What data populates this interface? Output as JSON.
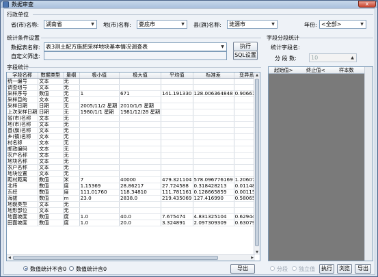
{
  "window": {
    "title": "数据审查",
    "close_label": "x"
  },
  "admin_group": {
    "title": "行政单位",
    "province_label": "省(市)名称:",
    "province_value": "湖南省",
    "city_label": "地(市)名称:",
    "city_value": "娄底市",
    "county_label": "县(旗)名称:",
    "county_value": "涟源市",
    "year_label": "年份:",
    "year_value": "<全部>"
  },
  "stats_cond": {
    "title": "统计条件设置",
    "table_label": "数据表名称:",
    "table_value": "表3测土配方施肥采样地块基本情况调查表",
    "filter_label": "自定义筛选:",
    "filter_value": "",
    "execute_label": "执行",
    "sql_label": "SQL设置"
  },
  "field_stats": {
    "title": "字段统计",
    "columns": [
      "字段名称",
      "数据类型",
      "量纲",
      "极小值",
      "极大值",
      "平均值",
      "标准差",
      "变异系"
    ],
    "rows": [
      [
        "统一编号",
        "文本",
        "无",
        "",
        "",
        "",
        "",
        ""
      ],
      [
        "调查组号",
        "文本",
        "无",
        "",
        "",
        "",
        "",
        ""
      ],
      [
        "采样序号",
        "数值",
        "无",
        "1",
        "671",
        "141.191330",
        "128.006364848",
        "0.906616"
      ],
      [
        "采样目的",
        "文本",
        "无",
        "",
        "",
        "",
        "",
        ""
      ],
      [
        "采样日期",
        "日期",
        "无",
        "2005/11/2 星期",
        "2010/1/5 星期",
        "",
        "",
        ""
      ],
      [
        "上次采样日期",
        "日期",
        "无",
        "1980/1/1 星期",
        "1981/12/28 星期",
        "",
        "",
        ""
      ],
      [
        "省(市)名称",
        "文本",
        "无",
        "",
        "",
        "",
        "",
        ""
      ],
      [
        "地(市)名称",
        "文本",
        "无",
        "",
        "",
        "",
        "",
        ""
      ],
      [
        "县(旗)名称",
        "文本",
        "无",
        "",
        "",
        "",
        "",
        ""
      ],
      [
        "乡(镇)名称",
        "文本",
        "无",
        "",
        "",
        "",
        "",
        ""
      ],
      [
        "村名称",
        "文本",
        "无",
        "",
        "",
        "",
        "",
        ""
      ],
      [
        "邮政编码",
        "文本",
        "无",
        "",
        "",
        "",
        "",
        ""
      ],
      [
        "农户名称",
        "文本",
        "无",
        "",
        "",
        "",
        "",
        ""
      ],
      [
        "地块名称",
        "文本",
        "无",
        "",
        "",
        "",
        "",
        ""
      ],
      [
        "农户名称",
        "文本",
        "无",
        "",
        "",
        "",
        "",
        ""
      ],
      [
        "地块位置",
        "文本",
        "无",
        "",
        "",
        "",
        "",
        ""
      ],
      [
        "距村距离",
        "数值",
        "米",
        "7",
        "40000",
        "479.321104",
        "578.096776169",
        "1.206074"
      ],
      [
        "北纬",
        "数值",
        "度",
        "1.15369",
        "28.86217",
        "27.724588",
        "0.318428213",
        "0.011485"
      ],
      [
        "东经",
        "数值",
        "度",
        "111.01760",
        "118.34810",
        "111.781161",
        "0.128665859",
        "0.001151"
      ],
      [
        "海拔",
        "数值",
        "m",
        "23.0",
        "2838.0",
        "219.435069",
        "127.416990",
        "0.580658"
      ],
      [
        "地貌类型",
        "文本",
        "无",
        "",
        "",
        "",
        "",
        ""
      ],
      [
        "地形部位",
        "文本",
        "无",
        "",
        "",
        "",
        "",
        ""
      ],
      [
        "地面坡度",
        "数值",
        "度",
        "1.0",
        "40.0",
        "7.675474",
        "4.831325104",
        "0.629448"
      ],
      [
        "田面坡度",
        "数值",
        "度",
        "1.0",
        "20.0",
        "3.324891",
        "2.097309309",
        "0.630796"
      ]
    ]
  },
  "segment_stats": {
    "title": "字段分段统计",
    "field_label": "统计字段名:",
    "count_label": "分 段 数:",
    "count_value": "10",
    "columns": [
      "起始值>",
      "终止值<",
      "样本数"
    ]
  },
  "bottom": {
    "radio_exclude_label": "数值统计不含0",
    "radio_include_label": "数值统计含0",
    "export_left_label": "导出",
    "radio_segment_label": "分段",
    "radio_independent_label": "独立值",
    "execute_label": "执行",
    "browse_label": "浏览",
    "export_right_label": "导出"
  }
}
